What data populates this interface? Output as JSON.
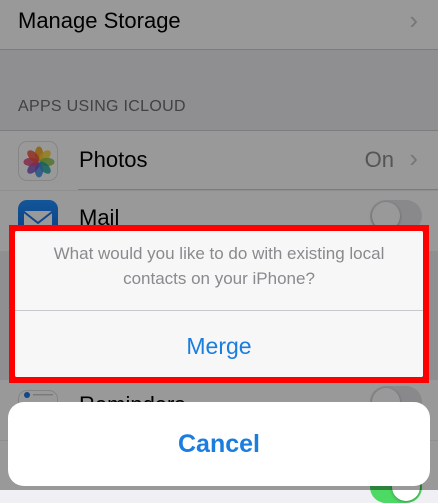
{
  "settings": {
    "manage_storage_label": "Manage Storage",
    "section_header": "APPS USING ICLOUD",
    "rows": [
      {
        "label": "Photos",
        "value": "On",
        "icon": "photos-icon"
      },
      {
        "label": "Mail",
        "icon": "mail-icon",
        "toggle": "off"
      },
      {
        "label": "Reminders",
        "icon": "reminders-icon",
        "toggle": "off"
      }
    ]
  },
  "action_sheet": {
    "message": "What would you like to do with existing local contacts on your iPhone?",
    "merge_label": "Merge",
    "cancel_label": "Cancel"
  },
  "colors": {
    "accent": "#1a7de0",
    "highlight": "#ff0000",
    "toggle_on": "#4cd964"
  }
}
